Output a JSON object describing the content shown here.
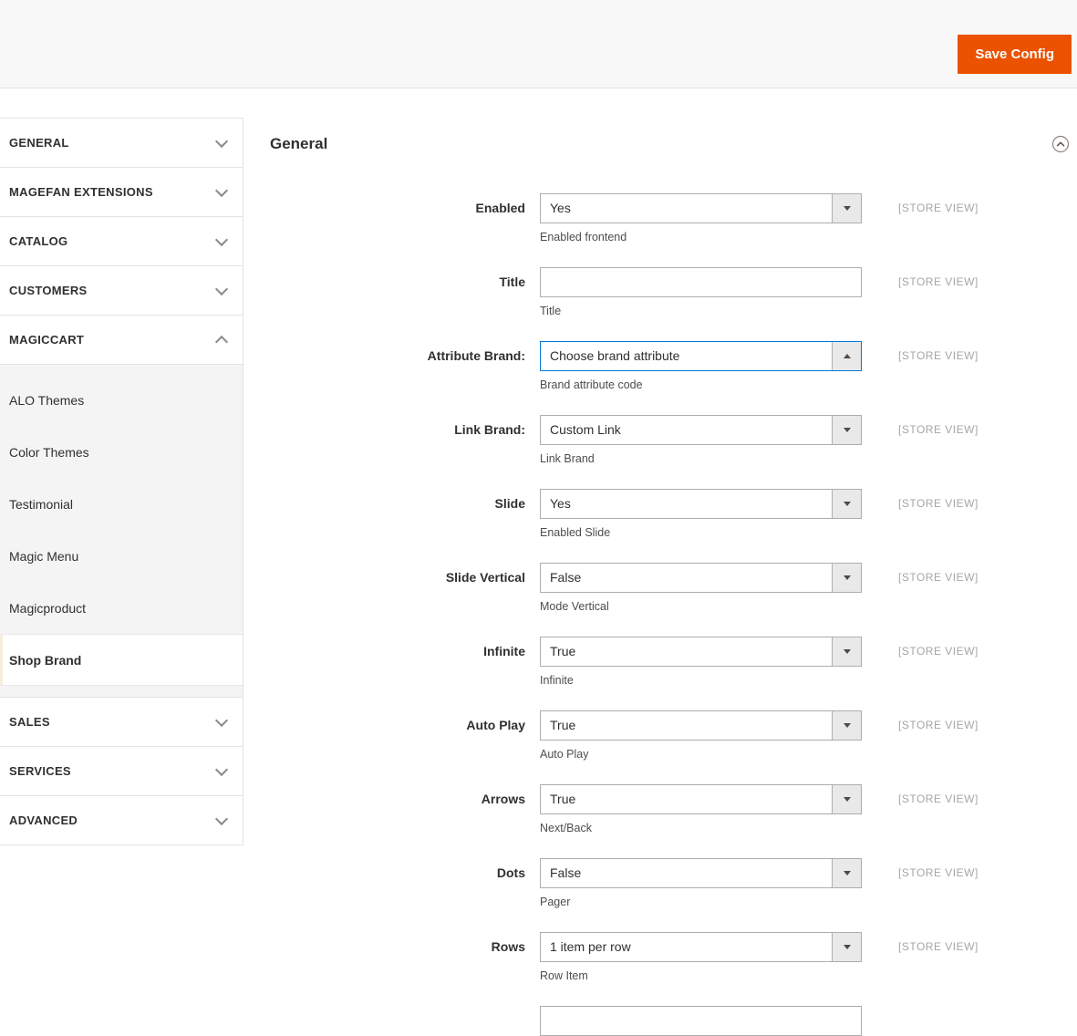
{
  "header": {
    "save_button": "Save Config"
  },
  "sidebar": {
    "sections": [
      {
        "label": "GENERAL",
        "expanded": false
      },
      {
        "label": "MAGEFAN EXTENSIONS",
        "expanded": false
      },
      {
        "label": "CATALOG",
        "expanded": false
      },
      {
        "label": "CUSTOMERS",
        "expanded": false
      },
      {
        "label": "MAGICCART",
        "expanded": true,
        "children": [
          "ALO Themes",
          "Color Themes",
          "Testimonial",
          "Magic Menu",
          "Magicproduct",
          "Shop Brand"
        ],
        "active_child": "Shop Brand"
      },
      {
        "label": "SALES",
        "expanded": false
      },
      {
        "label": "SERVICES",
        "expanded": false
      },
      {
        "label": "ADVANCED",
        "expanded": false
      }
    ]
  },
  "main": {
    "section_title": "General",
    "fields": [
      {
        "label": "Enabled",
        "type": "select",
        "value": "Yes",
        "hint": "Enabled frontend",
        "scope": "[STORE VIEW]"
      },
      {
        "label": "Title",
        "type": "text",
        "value": "",
        "hint": "Title",
        "scope": "[STORE VIEW]"
      },
      {
        "label": "Attribute Brand:",
        "type": "select",
        "value": "Choose brand attribute",
        "hint": "Brand attribute code",
        "scope": "[STORE VIEW]",
        "focused": true,
        "open": true
      },
      {
        "label": "Link Brand:",
        "type": "select",
        "value": "Custom Link",
        "hint": "Link Brand",
        "scope": "[STORE VIEW]"
      },
      {
        "label": "Slide",
        "type": "select",
        "value": "Yes",
        "hint": "Enabled Slide",
        "scope": "[STORE VIEW]"
      },
      {
        "label": "Slide Vertical",
        "type": "select",
        "value": "False",
        "hint": "Mode Vertical",
        "scope": "[STORE VIEW]"
      },
      {
        "label": "Infinite",
        "type": "select",
        "value": "True",
        "hint": "Infinite",
        "scope": "[STORE VIEW]"
      },
      {
        "label": "Auto Play",
        "type": "select",
        "value": "True",
        "hint": "Auto Play",
        "scope": "[STORE VIEW]"
      },
      {
        "label": "Arrows",
        "type": "select",
        "value": "True",
        "hint": "Next/Back",
        "scope": "[STORE VIEW]"
      },
      {
        "label": "Dots",
        "type": "select",
        "value": "False",
        "hint": "Pager",
        "scope": "[STORE VIEW]"
      },
      {
        "label": "Rows",
        "type": "select",
        "value": "1 item per row",
        "hint": "Row Item",
        "scope": "[STORE VIEW]"
      }
    ]
  },
  "colors": {
    "accent": "#eb5202",
    "focus": "#007bdb",
    "input_border": "#adadad",
    "divider": "#e3e3e3",
    "scope_text": "#a6a6a6"
  }
}
